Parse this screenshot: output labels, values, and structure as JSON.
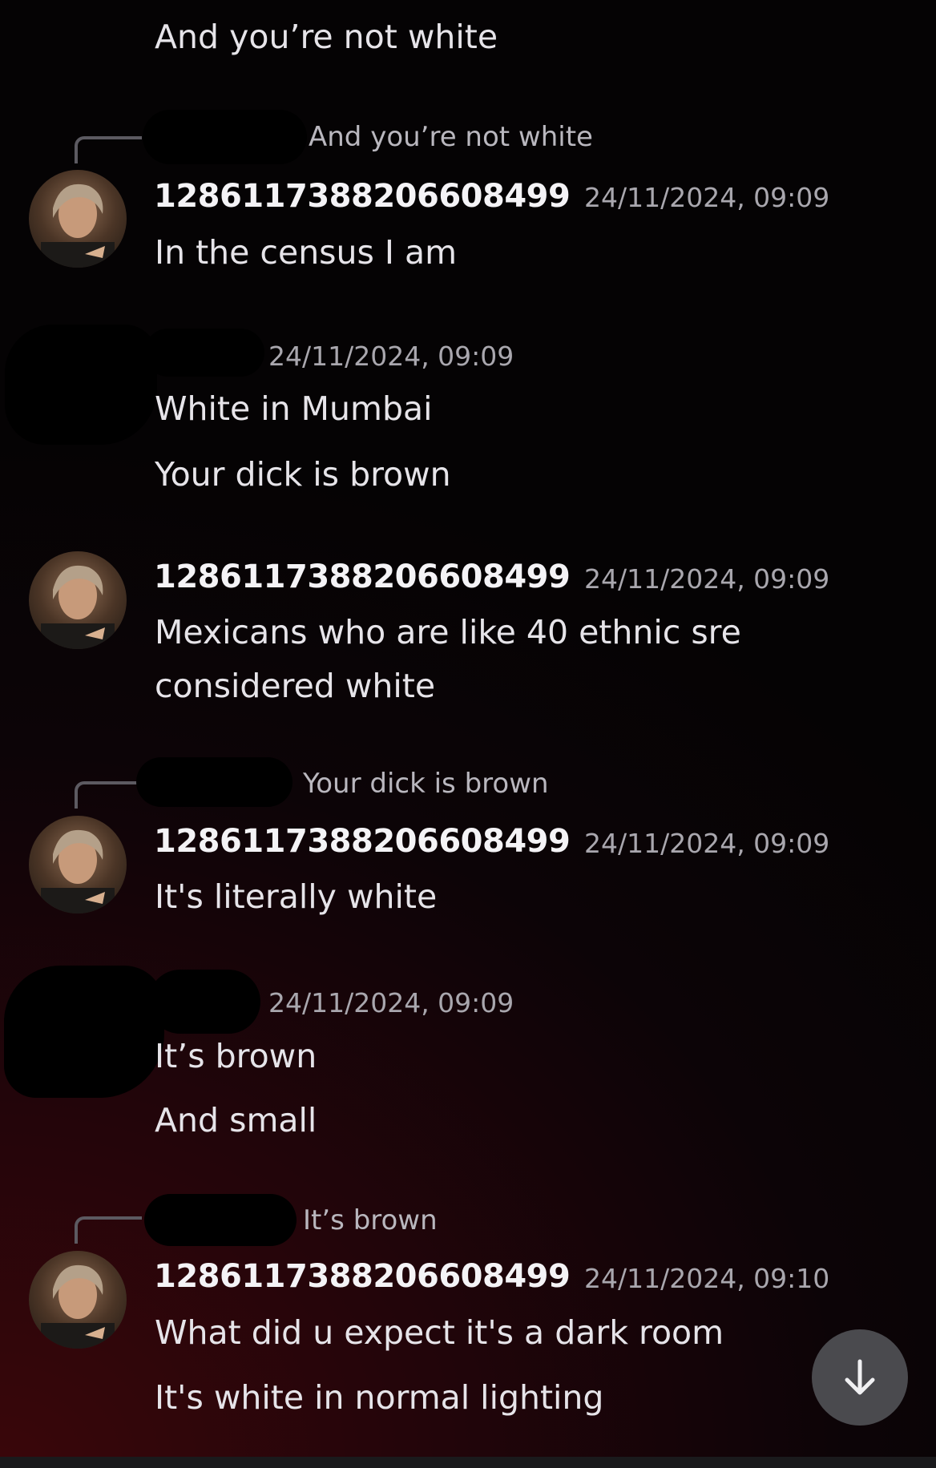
{
  "messages": {
    "m0_line1": "And you’re not white",
    "m1_reply": "And you’re not white",
    "m1_user": "1286117388206608499",
    "m1_time": "24/11/2024, 09:09",
    "m1_line1": "In the census I am",
    "m2_time": "24/11/2024, 09:09",
    "m2_line1": "White in Mumbai",
    "m2_line2": "Your dick is brown",
    "m3_user": "1286117388206608499",
    "m3_time": "24/11/2024, 09:09",
    "m3_line1": "Mexicans who are like 40 ethnic sre",
    "m3_line2": "considered white",
    "m4_reply": "Your dick is brown",
    "m4_user": "1286117388206608499",
    "m4_time": "24/11/2024, 09:09",
    "m4_line1": "It's literally white",
    "m5_time": "24/11/2024, 09:09",
    "m5_line1": "It’s brown",
    "m5_line2": "And small",
    "m6_reply": "It’s brown",
    "m6_user": "1286117388206608499",
    "m6_time": "24/11/2024, 09:10",
    "m6_line1": "What did u expect it's a dark room",
    "m6_line2": "It's white in normal lighting"
  },
  "icons": {
    "scroll": "arrow-down-icon",
    "avatar": "user-avatar"
  }
}
